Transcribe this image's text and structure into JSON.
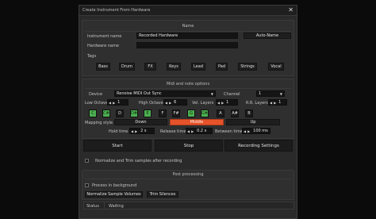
{
  "dialog": {
    "title": "Create Instrument From Hardware"
  },
  "name_section": {
    "header": "Name",
    "instrument_name_label": "Instrument name",
    "instrument_name_value": "Recorded Hardware",
    "autoname_button": "Auto-Name",
    "hardware_name_label": "Hardware name",
    "hardware_name_value": "",
    "tags_label": "Tags",
    "tags": [
      "Bass",
      "Drum",
      "FX",
      "Keys",
      "Lead",
      "Pad",
      "Strings",
      "Vocal"
    ]
  },
  "midi_section": {
    "header": "Midi and note options",
    "device_label": "Device",
    "device_value": "Renoise MIDI Out Sync",
    "channel_label": "Channel",
    "channel_value": "1",
    "low_octave_label": "Low Octave",
    "low_octave_value": "1",
    "high_octave_label": "High Octave",
    "high_octave_value": "6",
    "vel_layers_label": "Vel. Layers",
    "vel_layers_value": "1",
    "rr_layers_label": "R.R. Layers",
    "rr_layers_value": "1",
    "notes": [
      {
        "label": "C",
        "on": true
      },
      {
        "label": "C#",
        "on": true
      },
      {
        "label": "D",
        "on": false
      },
      {
        "label": "D#",
        "on": true
      },
      {
        "label": "E",
        "on": true
      },
      {
        "label": "F",
        "on": false
      },
      {
        "label": "F#",
        "on": false
      },
      {
        "label": "G",
        "on": true
      },
      {
        "label": "G#",
        "on": true
      },
      {
        "label": "A",
        "on": false
      },
      {
        "label": "A#",
        "on": false
      },
      {
        "label": "B",
        "on": false
      }
    ],
    "mapping_style_label": "Mapping style",
    "mapping_down": "Down",
    "mapping_middle": "Middle",
    "mapping_up": "Up",
    "hold_time_label": "Hold time",
    "hold_time_value": "2 s",
    "release_time_label": "Release time",
    "release_time_value": "0.2 s",
    "between_time_label": "Between time",
    "between_time_value": "100 ms"
  },
  "actions": {
    "start": "Start",
    "stop": "Stop",
    "recording_settings": "Recording Settings"
  },
  "normalize_trim": {
    "label": "Normalize and Trim samples after recording",
    "checked": false
  },
  "post": {
    "header": "Post processing",
    "process_bg_label": "Process in background",
    "process_bg_checked": false,
    "normalize_button": "Normalize Sample Volumes",
    "trim_button": "Trim Silences"
  },
  "status": {
    "label": "Status",
    "value": "Waiting"
  },
  "colors": {
    "accent_orange": "#e5532a",
    "note_on_green": "#4caf50"
  }
}
